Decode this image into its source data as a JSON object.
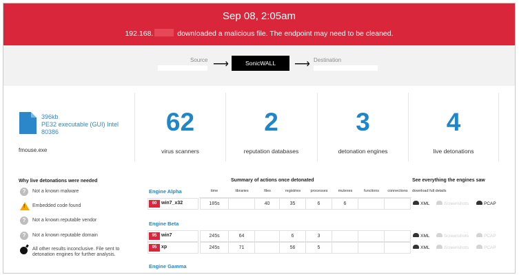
{
  "banner": {
    "timestamp": "Sep 08, 2:05am",
    "ip_prefix": "192.168.",
    "message": "downloaded a malicious file. The endpoint may need to be cleaned."
  },
  "flow": {
    "source_label": "Source",
    "device_label": "SonicWALL",
    "destination_label": "Destination",
    "arrow": "⟶"
  },
  "file": {
    "size": "396kb",
    "type": "PE32 executable (GUI) Intel 80386",
    "name": "fmouse.exe"
  },
  "stats": [
    {
      "value": "62",
      "label": "virus scanners"
    },
    {
      "value": "2",
      "label": "reputation databases"
    },
    {
      "value": "3",
      "label": "detonation engines"
    },
    {
      "value": "4",
      "label": "live detonations"
    }
  ],
  "reasons": {
    "title": "Why live detonations were needed",
    "items": [
      {
        "icon": "question-icon",
        "text": "Not a known malware"
      },
      {
        "icon": "warning-icon",
        "text": "Embedded code found"
      },
      {
        "icon": "question-icon",
        "text": "Not a known reputable vendor"
      },
      {
        "icon": "question-icon",
        "text": "Not a known reputable domain"
      },
      {
        "icon": "bomb-icon",
        "text": "All other results inconclusive. File sent to detonation engines for further analysis."
      }
    ]
  },
  "summary": {
    "title": "Summary of actions once detonated",
    "columns": [
      "time",
      "libraries",
      "files",
      "registries",
      "processes",
      "mutexes",
      "functions",
      "connections"
    ]
  },
  "downloads": {
    "title": "See everything the engines saw",
    "subtitle": "download full details",
    "xml": "XML",
    "screenshots": "Screenshots",
    "pcap": "PCAP"
  },
  "engines": [
    {
      "name": "Engine Alpha",
      "rows": [
        {
          "score": "60",
          "os": "win7_x32",
          "cells": [
            "185s",
            "",
            "40",
            "35",
            "6",
            "6",
            "",
            ""
          ],
          "screenshots_enabled": false,
          "pcap_enabled": true
        }
      ]
    },
    {
      "name": "Engine Beta",
      "rows": [
        {
          "score": "95",
          "os": "win7",
          "cells": [
            "245s",
            "64",
            "",
            "6",
            "3",
            "",
            "",
            ""
          ],
          "screenshots_enabled": false,
          "pcap_enabled": false
        },
        {
          "score": "95",
          "os": "xp",
          "cells": [
            "245s",
            "71",
            "",
            "56",
            "5",
            "",
            "",
            ""
          ],
          "screenshots_enabled": false,
          "pcap_enabled": false
        }
      ]
    },
    {
      "name": "Engine Gamma",
      "rows": []
    }
  ],
  "colors": {
    "banner": "#d9263a",
    "accent": "#1f86c8",
    "badge": "#d9263a"
  }
}
